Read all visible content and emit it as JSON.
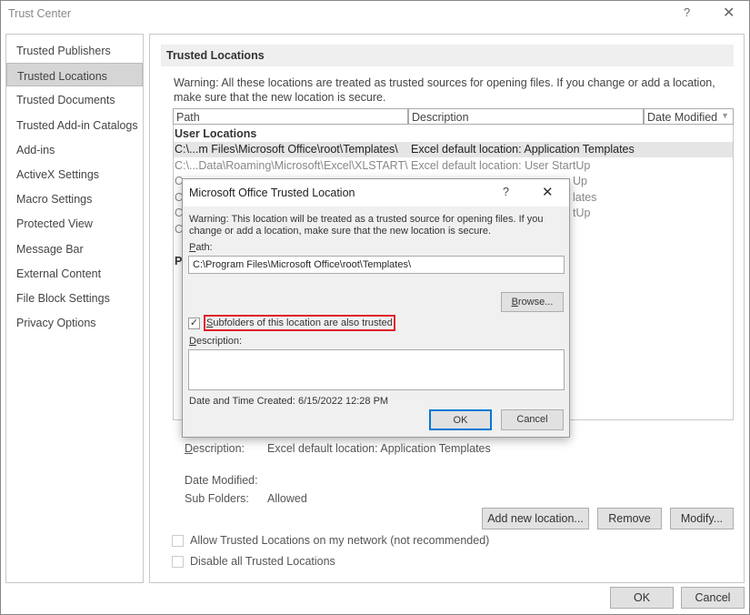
{
  "window": {
    "title": "Trust Center",
    "help": "?",
    "close": "✕"
  },
  "nav": [
    "Trusted Publishers",
    "Trusted Locations",
    "Trusted Documents",
    "Trusted Add-in Catalogs",
    "Add-ins",
    "ActiveX Settings",
    "Macro Settings",
    "Protected View",
    "Message Bar",
    "External Content",
    "File Block Settings",
    "Privacy Options"
  ],
  "main": {
    "heading": "Trusted Locations",
    "warning": "Warning: All these locations are treated as trusted sources for opening files.  If you change or add a location, make sure that the new location is secure.",
    "columns": [
      "Path",
      "Description",
      "Date Modified"
    ],
    "group_user": "User Locations",
    "rows": [
      {
        "path": "C:\\...m Files\\Microsoft Office\\root\\Templates\\",
        "desc": "Excel default location: Application Templates"
      },
      {
        "path": "C:\\...Data\\Roaming\\Microsoft\\Excel\\XLSTART\\",
        "desc": "Excel default location: User StartUp"
      },
      {
        "path": "C",
        "desc": "Up"
      },
      {
        "path": "C",
        "desc": "lates"
      },
      {
        "path": "C",
        "desc": "tUp"
      },
      {
        "path": "C",
        "desc": ""
      }
    ],
    "group_policy": "P",
    "details": {
      "desc_label": "Description:",
      "desc_value": "Excel default location: Application Templates",
      "date_label": "Date Modified:",
      "date_value": "",
      "sub_label": "Sub Folders:",
      "sub_value": "Allowed"
    },
    "buttons": {
      "add": "Add new location...",
      "remove": "Remove",
      "modify": "Modify..."
    },
    "allow_network": "Allow Trusted Locations on my network (not recommended)",
    "disable_all": "Disable all Trusted Locations"
  },
  "footer": {
    "ok": "OK",
    "cancel": "Cancel"
  },
  "dialog": {
    "title": "Microsoft Office Trusted Location",
    "help": "?",
    "close": "✕",
    "warning": "Warning: This location will be treated as a trusted source for opening files. If you change or add a location, make sure that the new location is secure.",
    "path_label": "Path:",
    "path_value": "C:\\Program Files\\Microsoft Office\\root\\Templates\\",
    "browse": "Browse...",
    "subfolders": "Subfolders of this location are also trusted",
    "subfolders_checked": true,
    "desc_label": "Description:",
    "desc_value": "",
    "created_label": "Date and Time Created:",
    "created_value": "6/15/2022 12:28 PM",
    "ok": "OK",
    "cancel": "Cancel",
    "highlight_color": "#e0202a"
  }
}
